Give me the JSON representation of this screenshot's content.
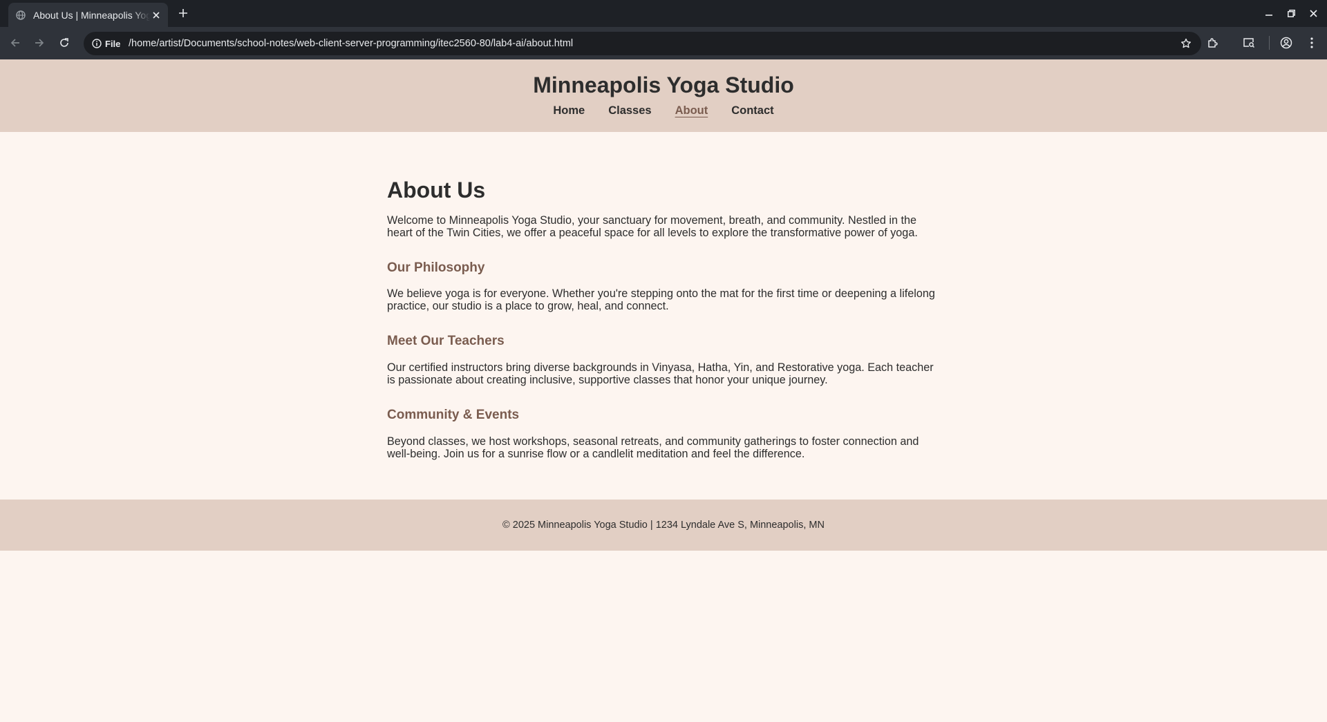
{
  "browser": {
    "tab_title": "About Us | Minneapolis Yoga Studio",
    "chip_label": "File",
    "url": "/home/artist/Documents/school-notes/web-client-server-programming/itec2560-80/lab4-ai/about.html",
    "icons": [
      "globe-icon",
      "close-icon",
      "plus-icon",
      "minimize-icon",
      "restore-icon",
      "close-window-icon",
      "back-arrow-icon",
      "forward-arrow-icon",
      "reload-icon",
      "info-icon",
      "star-icon",
      "extensions-icon",
      "media-search-icon",
      "profile-icon",
      "kebab-menu-icon"
    ]
  },
  "site": {
    "title": "Minneapolis Yoga Studio",
    "nav": [
      {
        "label": "Home",
        "active": false
      },
      {
        "label": "Classes",
        "active": false
      },
      {
        "label": "About",
        "active": true
      },
      {
        "label": "Contact",
        "active": false
      }
    ],
    "colors": {
      "header_bg": "#e2cfc4",
      "page_bg": "#fdf5f0",
      "accent": "#7a5c4f",
      "text": "#2d2d2d"
    }
  },
  "about": {
    "heading": "About Us",
    "intro": "Welcome to Minneapolis Yoga Studio, your sanctuary for movement, breath, and community. Nestled in the heart of the Twin Cities, we offer a peaceful space for all levels to explore the transformative power of yoga.",
    "sections": [
      {
        "heading": "Our Philosophy",
        "text": "We believe yoga is for everyone. Whether you're stepping onto the mat for the first time or deepening a lifelong practice, our studio is a place to grow, heal, and connect."
      },
      {
        "heading": "Meet Our Teachers",
        "text": "Our certified instructors bring diverse backgrounds in Vinyasa, Hatha, Yin, and Restorative yoga. Each teacher is passionate about creating inclusive, supportive classes that honor your unique journey."
      },
      {
        "heading": "Community & Events",
        "text": "Beyond classes, we host workshops, seasonal retreats, and community gatherings to foster connection and well-being. Join us for a sunrise flow or a candlelit meditation and feel the difference."
      }
    ]
  },
  "footer": {
    "text": "© 2025 Minneapolis Yoga Studio | 1234 Lyndale Ave S, Minneapolis, MN"
  }
}
